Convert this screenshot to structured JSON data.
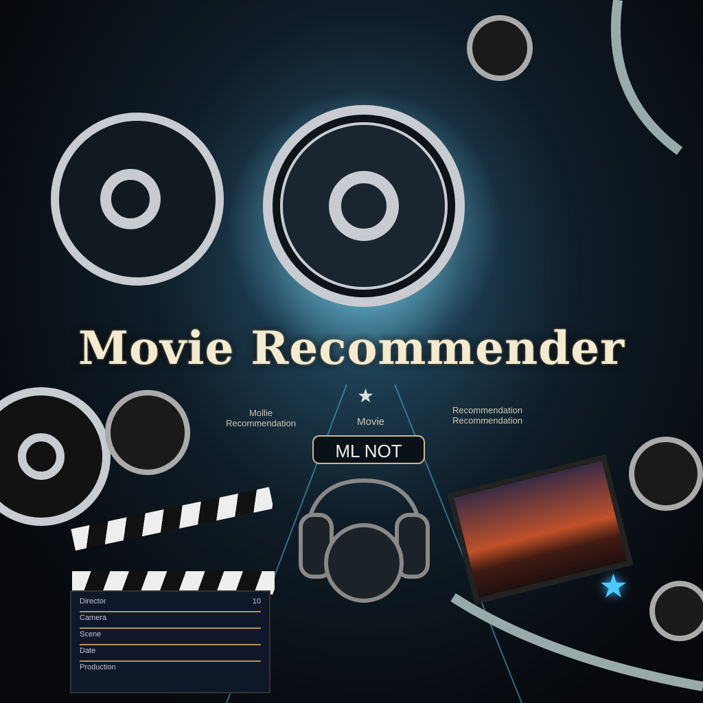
{
  "title": "Movie Recommender",
  "left_caption": {
    "line1": "Mollie",
    "line2": "Recommendation"
  },
  "center_caption": "Movie",
  "right_caption": {
    "line1": "Recommendation",
    "line2": "Recommendation"
  },
  "button_label": "ML NOT",
  "clapboard": {
    "rows": [
      "Director",
      "Camera",
      "Scene",
      "Date",
      "Production"
    ],
    "take": "10"
  },
  "colors": {
    "accent": "#4ec9ff",
    "title": "#f3ead0",
    "gold": "#c9b98f"
  }
}
